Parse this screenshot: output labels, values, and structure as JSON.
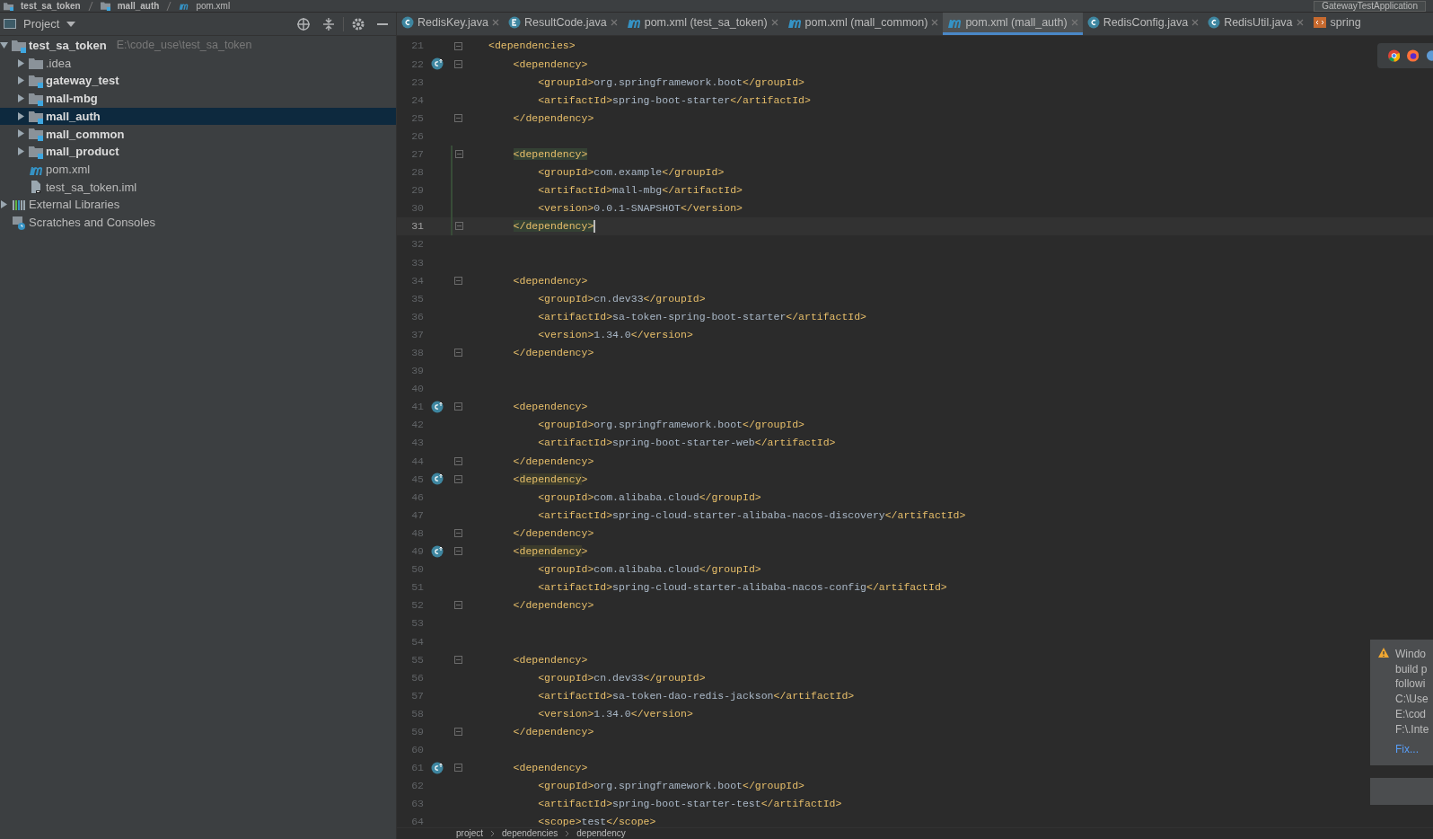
{
  "nav_bar": {
    "crumbs": [
      {
        "text": "test_sa_token",
        "kind": "project"
      },
      {
        "text": "mall_auth",
        "kind": "module"
      },
      {
        "text": "pom.xml",
        "kind": "maven"
      }
    ],
    "run_config": "GatewayTestApplication"
  },
  "project_panel": {
    "title": "Project",
    "tree": [
      {
        "name": "test_sa_token",
        "path": "E:\\code_use\\test_sa_token",
        "kind": "module",
        "bold": true,
        "expanded": true,
        "selected": false,
        "children": [
          {
            "name": ".idea",
            "kind": "folder",
            "bold": false,
            "expanded": false,
            "selected": false
          },
          {
            "name": "gateway_test",
            "kind": "module",
            "bold": true,
            "expanded": false,
            "selected": false
          },
          {
            "name": "mall-mbg",
            "kind": "module",
            "bold": true,
            "expanded": false,
            "selected": false
          },
          {
            "name": "mall_auth",
            "kind": "module",
            "bold": true,
            "expanded": false,
            "selected": true
          },
          {
            "name": "mall_common",
            "kind": "module",
            "bold": true,
            "expanded": false,
            "selected": false
          },
          {
            "name": "mall_product",
            "kind": "module",
            "bold": true,
            "expanded": false,
            "selected": false
          },
          {
            "name": "pom.xml",
            "kind": "maven",
            "bold": false,
            "selected": false
          },
          {
            "name": "test_sa_token.iml",
            "kind": "iml",
            "bold": false,
            "selected": false
          }
        ]
      },
      {
        "name": "External Libraries",
        "kind": "libraries",
        "bold": false,
        "expanded": false,
        "selected": false
      },
      {
        "name": "Scratches and Consoles",
        "kind": "scratches",
        "bold": false,
        "selected": false
      }
    ]
  },
  "tabs": [
    {
      "label": "RedisKey.java",
      "kind": "class",
      "selected": false
    },
    {
      "label": "ResultCode.java",
      "kind": "enum",
      "selected": false
    },
    {
      "label": "pom.xml (test_sa_token)",
      "kind": "maven",
      "selected": false
    },
    {
      "label": "pom.xml (mall_common)",
      "kind": "maven",
      "selected": false
    },
    {
      "label": "pom.xml (mall_auth)",
      "kind": "maven",
      "selected": true
    },
    {
      "label": "RedisConfig.java",
      "kind": "class",
      "selected": false
    },
    {
      "label": "RedisUtil.java",
      "kind": "class",
      "selected": false
    },
    {
      "label": "spring",
      "kind": "config",
      "selected": false
    }
  ],
  "editor": {
    "lines": [
      {
        "num": "21",
        "text": "<dependencies>",
        "fold": true
      },
      {
        "num": "22",
        "text": "    <dependency>",
        "fold": true,
        "gutter_icon": true
      },
      {
        "num": "23",
        "text": "        <groupId>org.springframework.boot</groupId>"
      },
      {
        "num": "24",
        "text": "        <artifactId>spring-boot-starter</artifactId>"
      },
      {
        "num": "25",
        "text": "    </dependency>",
        "fold": true
      },
      {
        "num": "26"
      },
      {
        "num": "27",
        "text": "    <dependency>",
        "fold": true,
        "tag_highlighted": true,
        "changed": true
      },
      {
        "num": "28",
        "text": "        <groupId>com.example</groupId>",
        "changed": true
      },
      {
        "num": "29",
        "text": "        <artifactId>mall-mbg</artifactId>",
        "changed": true
      },
      {
        "num": "30",
        "text": "        <version>0.0.1-SNAPSHOT</version>",
        "changed": true
      },
      {
        "num": "31",
        "text": "    </dependency>",
        "fold": true,
        "tag_highlighted": true,
        "current": true,
        "changed": true
      },
      {
        "num": "32"
      },
      {
        "num": "33"
      },
      {
        "num": "34",
        "text": "    <dependency>",
        "fold": true
      },
      {
        "num": "35",
        "text": "        <groupId>cn.dev33</groupId>"
      },
      {
        "num": "36",
        "text": "        <artifactId>sa-token-spring-boot-starter</artifactId>"
      },
      {
        "num": "37",
        "text": "        <version>1.34.0</version>"
      },
      {
        "num": "38",
        "text": "    </dependency>",
        "fold": true
      },
      {
        "num": "39"
      },
      {
        "num": "40"
      },
      {
        "num": "41",
        "text": "    <dependency>",
        "fold": true,
        "gutter_icon": true
      },
      {
        "num": "42",
        "text": "        <groupId>org.springframework.boot</groupId>"
      },
      {
        "num": "43",
        "text": "        <artifactId>spring-boot-starter-web</artifactId>"
      },
      {
        "num": "44",
        "text": "    </dependency>",
        "fold": true
      },
      {
        "num": "45",
        "text": "    <dependency>",
        "fold": true,
        "gutter_icon": true,
        "word_highlighted": true
      },
      {
        "num": "46",
        "text": "        <groupId>com.alibaba.cloud</groupId>"
      },
      {
        "num": "47",
        "text": "        <artifactId>spring-cloud-starter-alibaba-nacos-discovery</artifactId>"
      },
      {
        "num": "48",
        "text": "    </dependency>",
        "fold": true
      },
      {
        "num": "49",
        "text": "    <dependency>",
        "fold": true,
        "gutter_icon": true,
        "word_highlighted": true
      },
      {
        "num": "50",
        "text": "        <groupId>com.alibaba.cloud</groupId>"
      },
      {
        "num": "51",
        "text": "        <artifactId>spring-cloud-starter-alibaba-nacos-config</artifactId>"
      },
      {
        "num": "52",
        "text": "    </dependency>",
        "fold": true
      },
      {
        "num": "53"
      },
      {
        "num": "54"
      },
      {
        "num": "55",
        "text": "    <dependency>",
        "fold": true
      },
      {
        "num": "56",
        "text": "        <groupId>cn.dev33</groupId>"
      },
      {
        "num": "57",
        "text": "        <artifactId>sa-token-dao-redis-jackson</artifactId>"
      },
      {
        "num": "58",
        "text": "        <version>1.34.0</version>"
      },
      {
        "num": "59",
        "text": "    </dependency>",
        "fold": true
      },
      {
        "num": "60"
      },
      {
        "num": "61",
        "text": "    <dependency>",
        "fold": true,
        "gutter_icon": true
      },
      {
        "num": "62",
        "text": "        <groupId>org.springframework.boot</groupId>"
      },
      {
        "num": "63",
        "text": "        <artifactId>spring-boot-starter-test</artifactId>"
      },
      {
        "num": "64",
        "text": "        <scope>test</scope>"
      }
    ]
  },
  "breadcrumbs": [
    "project",
    "dependencies",
    "dependency"
  ],
  "notification": {
    "lines": [
      "Windo",
      "build p",
      "followi",
      "C:\\Use",
      "E:\\cod",
      "F:\\.Inte"
    ],
    "action": "Fix..."
  }
}
